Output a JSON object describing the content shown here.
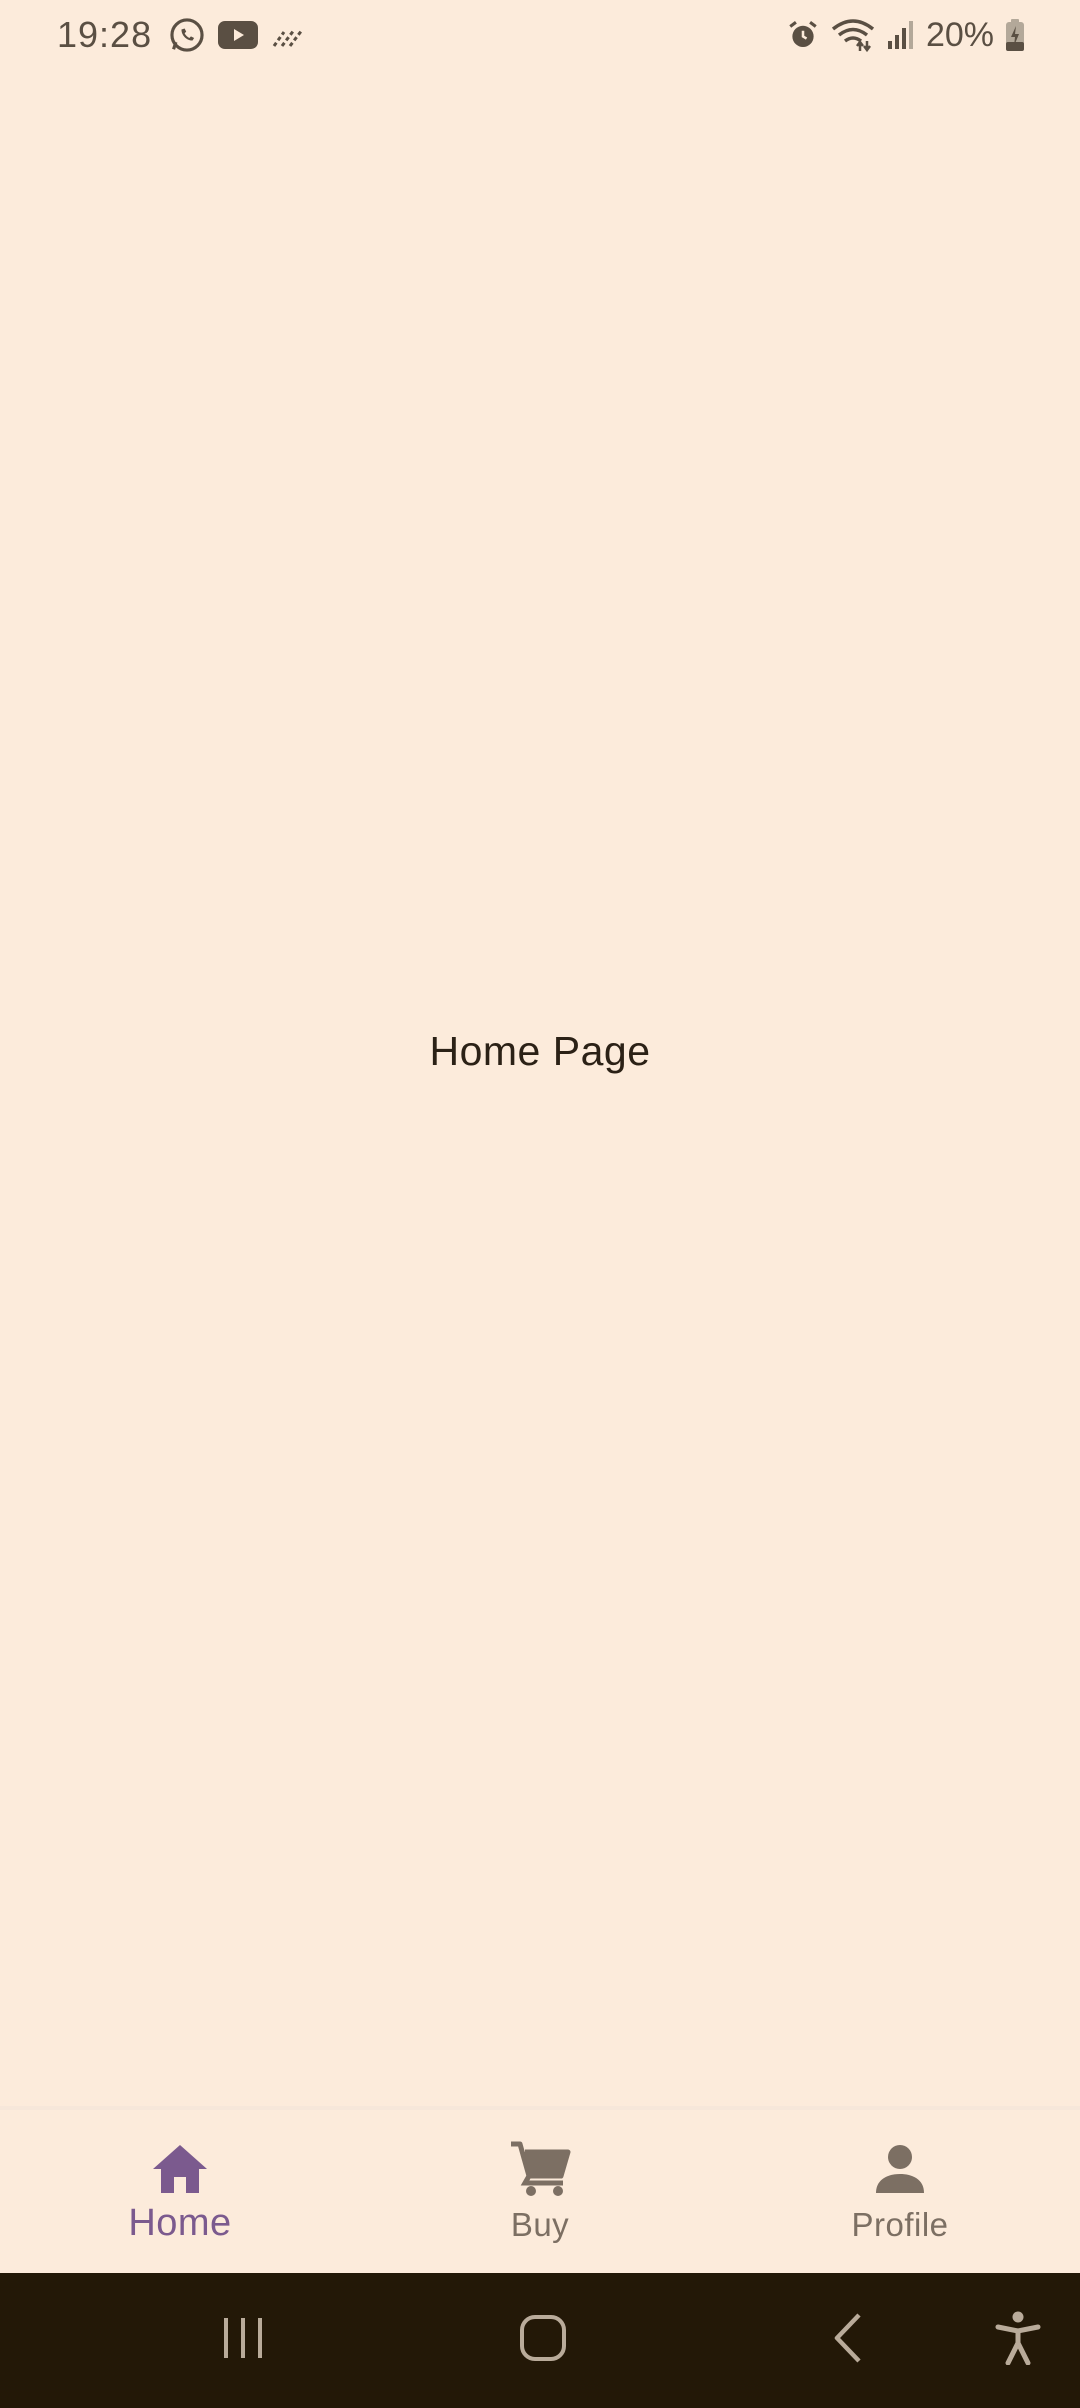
{
  "status_bar": {
    "time": "19:28",
    "battery_percent": "20%",
    "left_icons": [
      "whatsapp-icon",
      "youtube-icon",
      "data-saver-icon"
    ],
    "right_icons": [
      "alarm-icon",
      "wifi-icon",
      "signal-icon",
      "battery-charging-icon"
    ]
  },
  "main": {
    "page_label": "Home Page"
  },
  "bottom_nav": {
    "items": [
      {
        "label": "Home",
        "icon": "home-icon",
        "active": true
      },
      {
        "label": "Buy",
        "icon": "cart-icon",
        "active": false
      },
      {
        "label": "Profile",
        "icon": "person-icon",
        "active": false
      }
    ]
  },
  "system_nav": {
    "buttons": [
      "recent-apps-icon",
      "home-button-icon",
      "back-icon",
      "accessibility-icon"
    ]
  },
  "colors": {
    "background": "#fcebdb",
    "accent": "#7b5a8e",
    "inactive": "#7c6f63",
    "system_bar": "#231807"
  }
}
